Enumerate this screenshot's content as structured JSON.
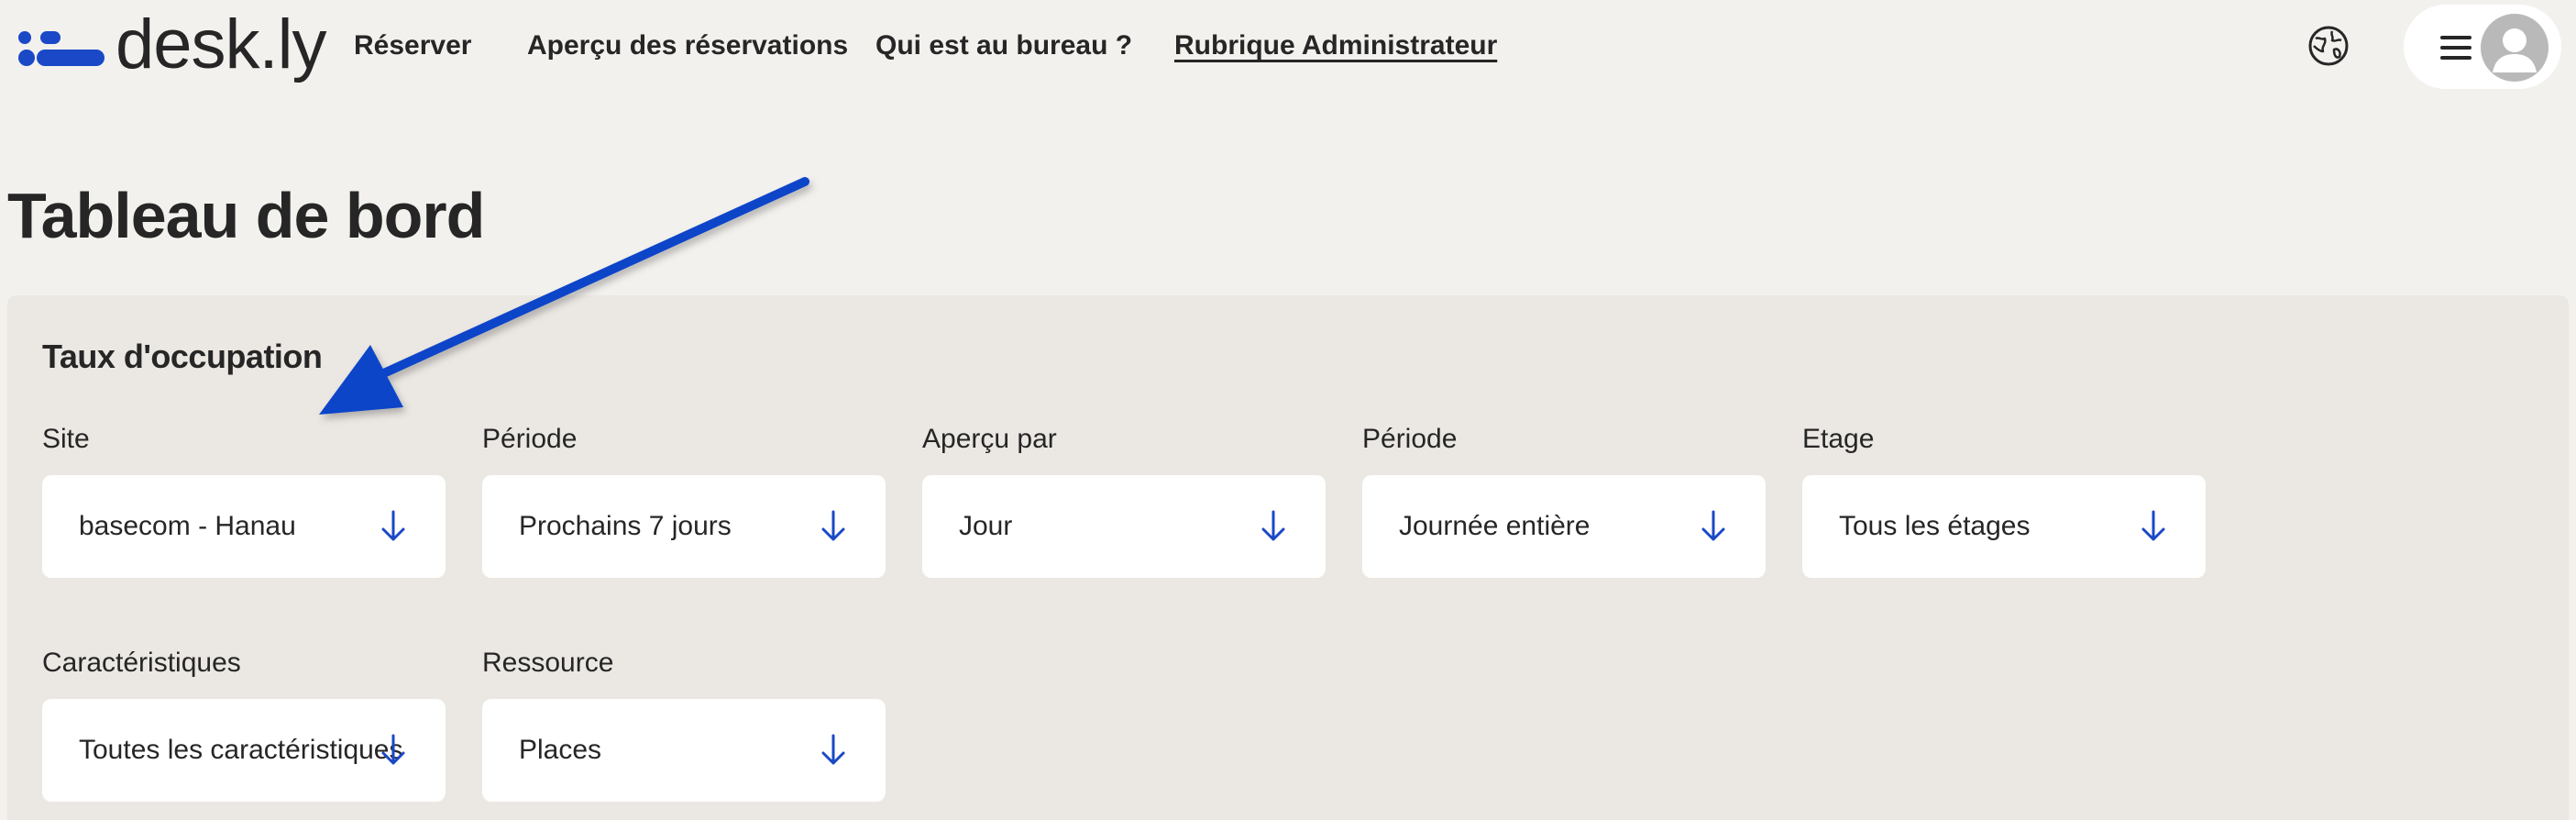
{
  "brand": {
    "name": "desk.ly",
    "color": "#1a48c7"
  },
  "nav": {
    "items": [
      {
        "label": "Réserver"
      },
      {
        "label": "Aperçu des réservations"
      },
      {
        "label": "Qui est au bureau ?"
      },
      {
        "label": "Rubrique Administrateur",
        "active": true
      }
    ]
  },
  "header": {
    "language_icon": "globe-icon",
    "menu_icon": "hamburger-icon",
    "avatar_icon": "user-avatar-icon"
  },
  "page": {
    "title": "Tableau de bord"
  },
  "occupancy": {
    "title": "Taux d'occupation",
    "filters": [
      {
        "label": "Site",
        "value": "basecom - Hanau"
      },
      {
        "label": "Période",
        "value": "Prochains 7 jours"
      },
      {
        "label": "Aperçu par",
        "value": "Jour"
      },
      {
        "label": "Période",
        "value": "Journée entière"
      },
      {
        "label": "Etage",
        "value": "Tous les étages"
      },
      {
        "label": "Caractéristiques",
        "value": "Toutes les caractéristiques"
      },
      {
        "label": "Ressource",
        "value": "Places"
      }
    ]
  },
  "colors": {
    "background": "#f3f1ee",
    "panel": "#ebe7e3",
    "accent": "#1a48c7",
    "annotation_arrow": "#0b44c9"
  }
}
